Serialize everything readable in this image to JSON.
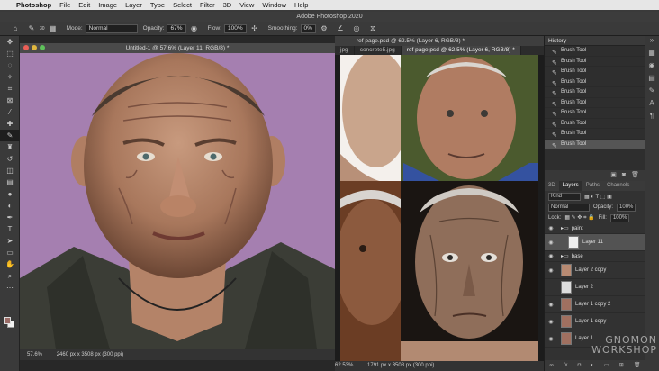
{
  "menubar": {
    "app": "Photoshop",
    "items": [
      "File",
      "Edit",
      "Image",
      "Layer",
      "Type",
      "Select",
      "Filter",
      "3D",
      "View",
      "Window",
      "Help"
    ]
  },
  "app_title": "Adobe Photoshop 2020",
  "options": {
    "mode_label": "Mode:",
    "mode_value": "Normal",
    "opacity_label": "Opacity:",
    "opacity_value": "67%",
    "flow_label": "Flow:",
    "flow_value": "100%",
    "smoothing_label": "Smoothing:",
    "smoothing_value": "0%",
    "brush_size": "30"
  },
  "doc1": {
    "title": "Untitled-1 @ 57.6% (Layer 11, RGB/8) *",
    "zoom": "57.6%",
    "info": "2460 px x 3508 px (300 ppi)"
  },
  "doc2": {
    "title": "ref page.psd @ 62.5% (Layer 6, RGB/8) *",
    "tabs": [
      "jpg",
      "concrete5.jpg",
      "ref page.psd @ 62.5% (Layer 6, RGB/8) *"
    ],
    "zoom": "62.53%",
    "info": "1791 px x 3508 px (300 ppi)"
  },
  "history": {
    "title": "History",
    "items": [
      "Brush Tool",
      "Brush Tool",
      "Brush Tool",
      "Brush Tool",
      "Brush Tool",
      "Brush Tool",
      "Brush Tool",
      "Brush Tool",
      "Brush Tool",
      "Brush Tool"
    ]
  },
  "layers_panel": {
    "tabs": [
      "3D",
      "Layers",
      "Paths",
      "Channels"
    ],
    "kind": "Kind",
    "blend": "Normal",
    "opacity_label": "Opacity:",
    "opacity": "100%",
    "lock_label": "Lock:",
    "fill_label": "Fill:",
    "fill": "100%",
    "layers": [
      {
        "name": "paint",
        "group": true
      },
      {
        "name": "Layer 11",
        "group": false
      },
      {
        "name": "base",
        "group": true
      },
      {
        "name": "Layer 2 copy",
        "group": false
      },
      {
        "name": "Layer 2",
        "group": false
      },
      {
        "name": "Layer 1 copy 2",
        "group": false
      },
      {
        "name": "Layer 1 copy",
        "group": false
      },
      {
        "name": "Layer 1",
        "group": false
      }
    ]
  },
  "watermark": {
    "line1": "GNOMON",
    "line2": "WORKSHOP"
  },
  "colors": {
    "canvas_bg": "#a57fb0",
    "foreground": "#9a6b66"
  }
}
